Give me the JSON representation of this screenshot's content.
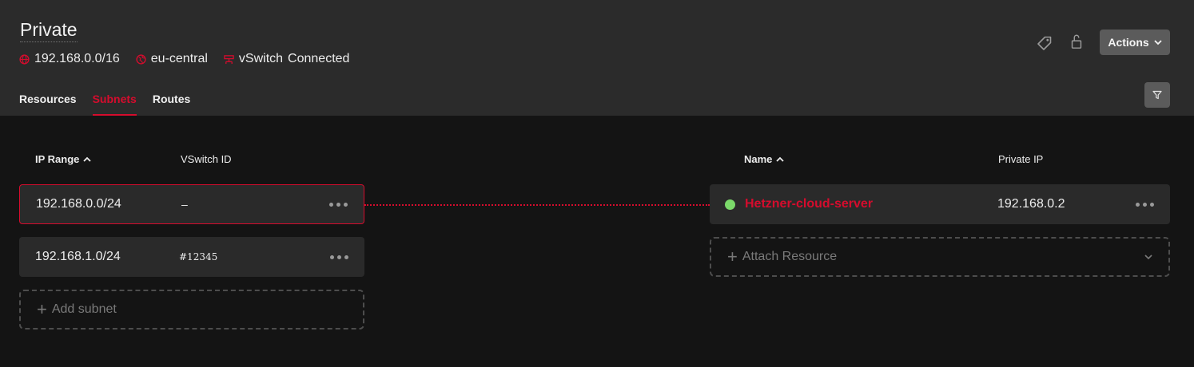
{
  "header": {
    "title": "Private",
    "ip_range": "192.168.0.0/16",
    "location": "eu-central",
    "vswitch_label": "vSwitch",
    "vswitch_status": "Connected",
    "actions_label": "Actions"
  },
  "tabs": [
    {
      "label": "Resources",
      "active": false
    },
    {
      "label": "Subnets",
      "active": true
    },
    {
      "label": "Routes",
      "active": false
    }
  ],
  "subnets_table": {
    "columns": [
      "IP Range",
      "VSwitch ID"
    ],
    "rows": [
      {
        "ip_range": "192.168.0.0/24",
        "vswitch_id": "–",
        "selected": true
      },
      {
        "ip_range": "192.168.1.0/24",
        "vswitch_id": "#12345",
        "selected": false
      }
    ],
    "add_label": "Add subnet"
  },
  "resources_table": {
    "columns": [
      "Name",
      "Private IP"
    ],
    "rows": [
      {
        "name": "Hetzner-cloud-server",
        "private_ip": "192.168.0.2",
        "status": "running"
      }
    ],
    "attach_label": "Attach Resource"
  },
  "colors": {
    "accent": "#d50c2d",
    "status_running": "#7bd96a",
    "header_bg": "#2b2b2b",
    "page_bg": "#141414"
  },
  "icons": [
    "globe-icon",
    "location-icon",
    "vswitch-icon",
    "label-icon",
    "lock-icon",
    "chevron-down-icon",
    "filter-icon",
    "sort-asc-icon",
    "plus-icon",
    "more-icon"
  ]
}
